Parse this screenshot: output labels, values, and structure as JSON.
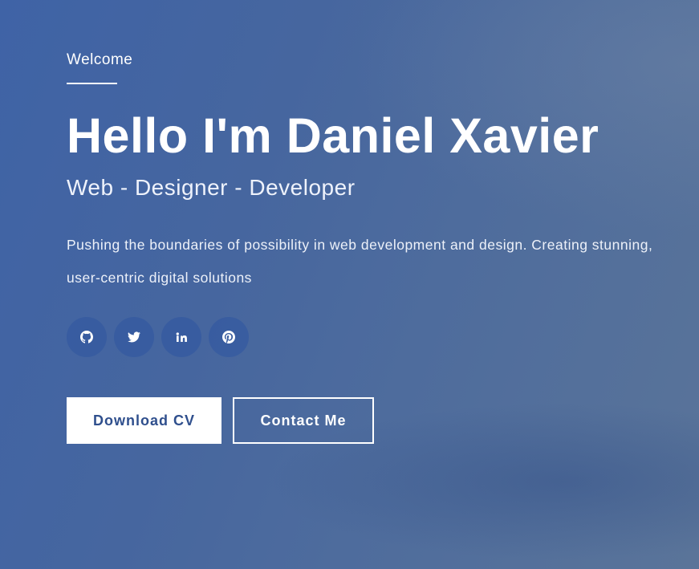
{
  "hero": {
    "welcome": "Welcome",
    "title": "Hello I'm Daniel Xavier",
    "subtitle": "Web - Designer - Developer",
    "description": "Pushing the boundaries of possibility in web development and design. Creating stunning, user-centric digital solutions"
  },
  "social_links": [
    {
      "icon": "github-icon"
    },
    {
      "icon": "twitter-icon"
    },
    {
      "icon": "linkedin-icon"
    },
    {
      "icon": "pinterest-icon"
    }
  ],
  "buttons": {
    "download_cv": "Download CV",
    "contact_me": "Contact Me"
  },
  "colors": {
    "background": "#46669f",
    "primary_button_text": "#2f4f8d",
    "social_circle": "#345aa0"
  }
}
